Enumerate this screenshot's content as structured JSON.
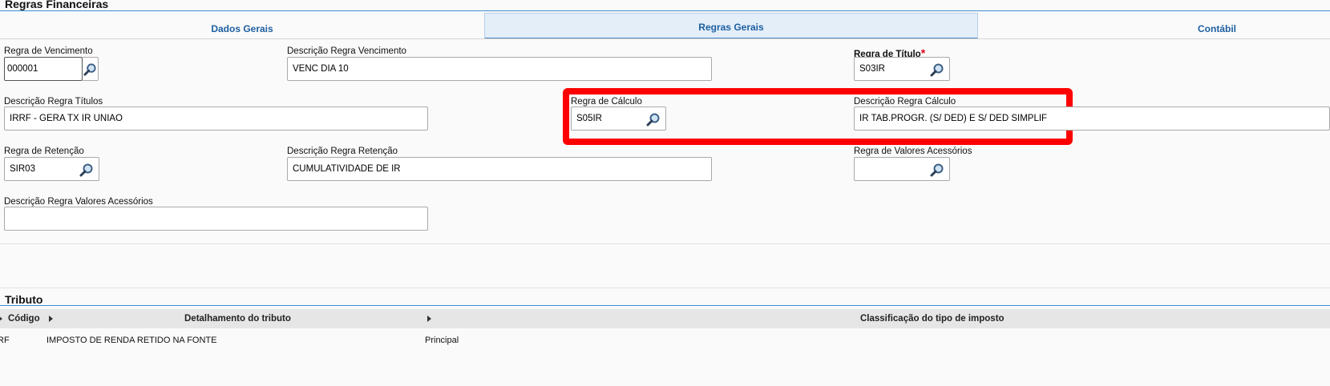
{
  "header": {
    "title": "Regras Financeiras"
  },
  "tabs": [
    {
      "label": "Dados Gerais"
    },
    {
      "label": "Regras Gerais"
    },
    {
      "label": "Contábil"
    }
  ],
  "form": {
    "regra_vencimento": {
      "label": "Regra de Vencimento",
      "value": "000001"
    },
    "desc_regra_vencimento": {
      "label": "Descrição Regra Vencimento",
      "value": "VENC DIA 10"
    },
    "regra_titulo": {
      "label": "Regra de Título",
      "required_mark": "*",
      "value": "S03IR"
    },
    "desc_regra_titulos": {
      "label": "Descrição Regra Títulos",
      "value": "IRRF - GERA TX IR UNIAO"
    },
    "regra_calculo": {
      "label": "Regra de Cálculo",
      "value": "S05IR"
    },
    "desc_regra_calculo": {
      "label": "Descrição Regra Cálculo",
      "value": "IR  TAB.PROGR. (S/ DED) E S/ DED SIMPLIF"
    },
    "regra_retencao": {
      "label": "Regra de Retenção",
      "value": "SIR03"
    },
    "desc_regra_retencao": {
      "label": "Descrição Regra Retenção",
      "value": "CUMULATIVIDADE DE IR"
    },
    "regra_valores_acessorios": {
      "label": "Regra de Valores Acessórios",
      "value": ""
    },
    "desc_regra_valores_acessorios": {
      "label": "Descrição Regra Valores Acessórios",
      "value": ""
    }
  },
  "tributo": {
    "title": "Tributo",
    "columns": [
      "Código",
      "Detalhamento do tributo",
      "Classificação do tipo de imposto"
    ],
    "rows": [
      {
        "codigo": "IRF",
        "detalhamento": "IMPOSTO DE RENDA RETIDO NA FONTE",
        "classificacao": "Principal"
      }
    ]
  },
  "colors": {
    "accent": "#3a8fd0",
    "tab_text": "#1d5fa0",
    "highlight": "#ff0000",
    "required": "#e0001b"
  },
  "icons": {
    "lookup": "magnifier-icon",
    "column_menu": "triangle-right-icon"
  }
}
